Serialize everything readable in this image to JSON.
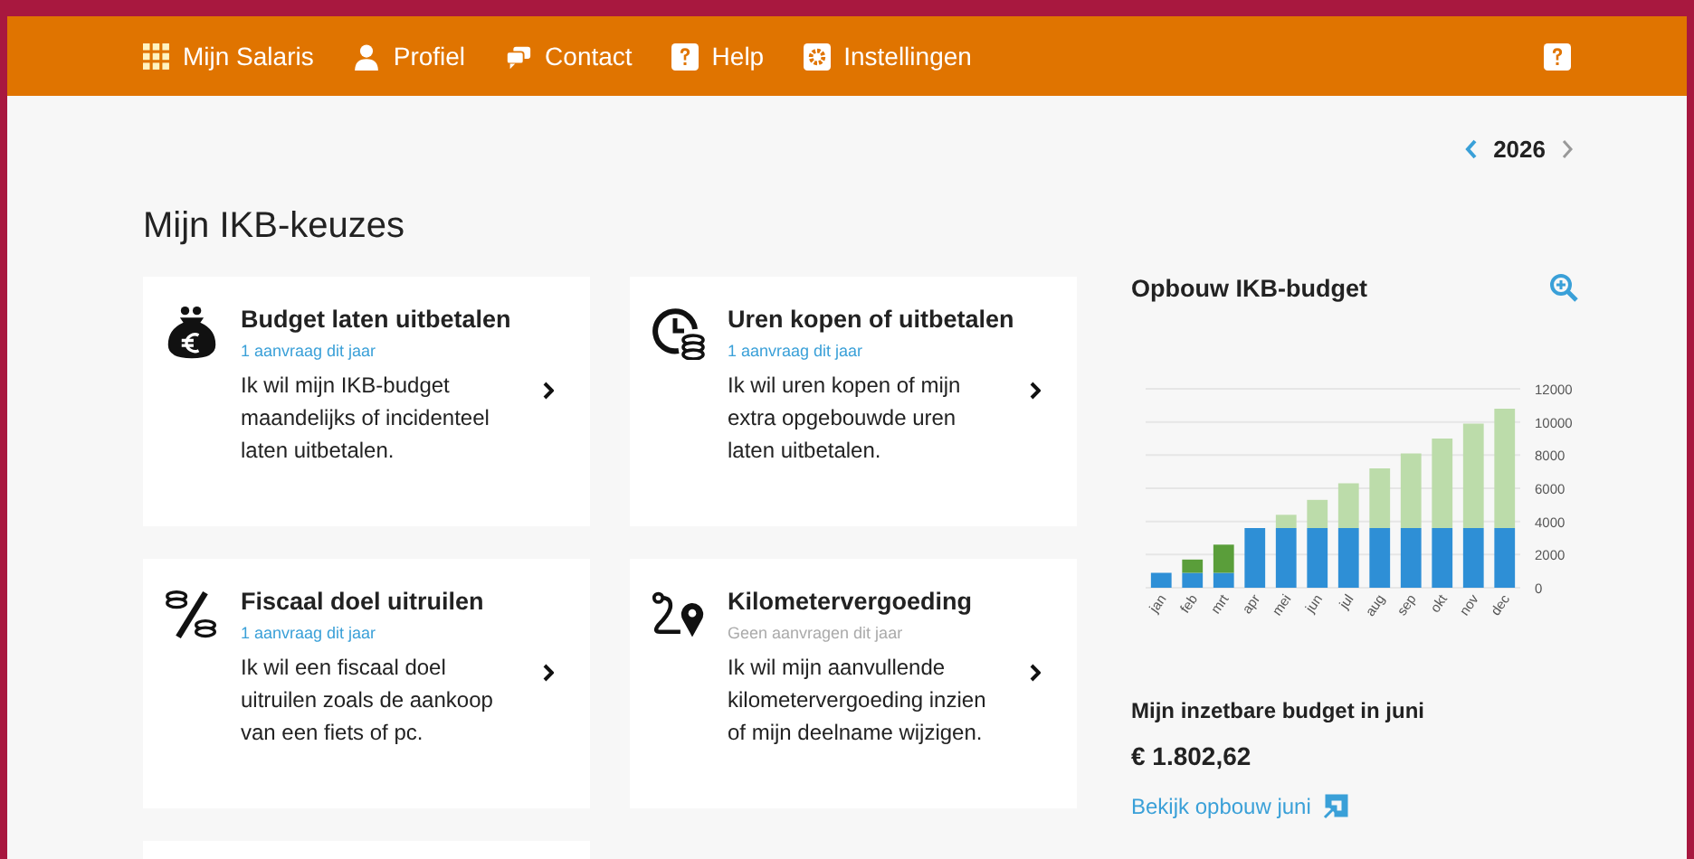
{
  "nav": {
    "items": [
      {
        "kind": "grid",
        "label": "Mijn Salaris"
      },
      {
        "kind": "person",
        "label": "Profiel"
      },
      {
        "kind": "chat",
        "label": "Contact"
      },
      {
        "kind": "help",
        "label": "Help"
      },
      {
        "kind": "gear",
        "label": "Instellingen"
      }
    ]
  },
  "year": "2026",
  "heading": "Mijn IKB-keuzes",
  "cards": [
    {
      "kind": "purse",
      "title": "Budget laten uitbetalen",
      "requests": "1 aanvraag dit jaar",
      "has_requests": true,
      "description": "Ik wil mijn IKB-budget maandelijks of incidenteel laten uitbetalen."
    },
    {
      "kind": "clock",
      "title": "Uren kopen of uitbetalen",
      "requests": "1 aanvraag dit jaar",
      "has_requests": true,
      "description": "Ik wil uren kopen of mijn extra opgebouwde uren laten uitbetalen."
    },
    {
      "kind": "percent",
      "title": "Fiscaal doel uitruilen",
      "requests": "1 aanvraag dit jaar",
      "has_requests": true,
      "description": "Ik wil een fiscaal doel uitruilen zoals de aankoop van een fiets of pc."
    },
    {
      "kind": "route",
      "title": "Kilometervergoeding",
      "requests": "Geen aanvragen dit jaar",
      "has_requests": false,
      "description": "Ik wil mijn aanvullende kilometervergoeding inzien of mijn deelname wijzigen."
    }
  ],
  "budget_panel": {
    "title": "Opbouw IKB-budget",
    "chart_data": {
      "type": "bar",
      "stacked": true,
      "grid": true,
      "categories": [
        "jan",
        "feb",
        "mrt",
        "apr",
        "mei",
        "jun",
        "jul",
        "aug",
        "sep",
        "okt",
        "nov",
        "dec"
      ],
      "ylim": [
        0,
        12000
      ],
      "yticks": [
        0,
        2000,
        4000,
        6000,
        8000,
        10000,
        12000
      ],
      "series": [
        {
          "color": "#2e8fd6",
          "values": [
            900,
            900,
            900,
            3600,
            3600,
            3600,
            3600,
            3600,
            3600,
            3600,
            3600,
            3600
          ]
        },
        {
          "color": "#5a9e3a",
          "values": [
            0,
            800,
            1700,
            0,
            0,
            0,
            0,
            0,
            0,
            0,
            0,
            0
          ]
        },
        {
          "color": "#bcdcaa",
          "values": [
            0,
            0,
            0,
            0,
            800,
            1700,
            2700,
            3600,
            4500,
            5400,
            6300,
            7200
          ]
        }
      ]
    },
    "available_label": "Mijn inzetbare budget in juni",
    "available_amount": "€ 1.802,62",
    "link": "Bekijk opbouw juni"
  }
}
